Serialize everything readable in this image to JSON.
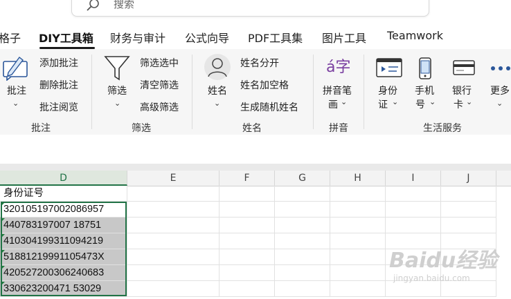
{
  "search": {
    "placeholder": "搜索"
  },
  "tabs": [
    "格子",
    "DIY工具箱",
    "财务与审计",
    "公式向导",
    "PDF工具集",
    "图片工具",
    "Teamwork"
  ],
  "active_tab": "DIY工具箱",
  "ribbon": {
    "annotate": {
      "big_label": "批注",
      "items": [
        "添加批注",
        "删除批注",
        "批注阅览"
      ],
      "group": "批注"
    },
    "filter": {
      "big_label": "筛选",
      "items": [
        "筛选选中",
        "清空筛选",
        "高级筛选"
      ],
      "group": "筛选"
    },
    "name": {
      "big_label": "姓名",
      "items": [
        "姓名分开",
        "姓名加空格",
        "生成随机姓名"
      ],
      "group": "姓名"
    },
    "pinyin": {
      "big_label_1": "拼音笔",
      "big_label_2": "画",
      "icon_text": "á字",
      "group": "拼音"
    },
    "life": {
      "id_card_1": "身份",
      "id_card_2": "证",
      "phone_1": "手机",
      "phone_2": "号",
      "bank_1": "银行",
      "bank_2": "卡",
      "more": "更多",
      "group": "生活服务"
    }
  },
  "columns": [
    "D",
    "E",
    "F",
    "G",
    "H",
    "I",
    "J"
  ],
  "selected_column": "D",
  "header_cell": "身份证号",
  "id_numbers": [
    "320105197002086957",
    "440783197007 18751",
    "410304199311094219",
    "51881219991105473X",
    "420527200306240683",
    "330623200471 53029"
  ],
  "watermark": {
    "brand": "Baidu经验",
    "url": "jingyan.baidu.com"
  }
}
